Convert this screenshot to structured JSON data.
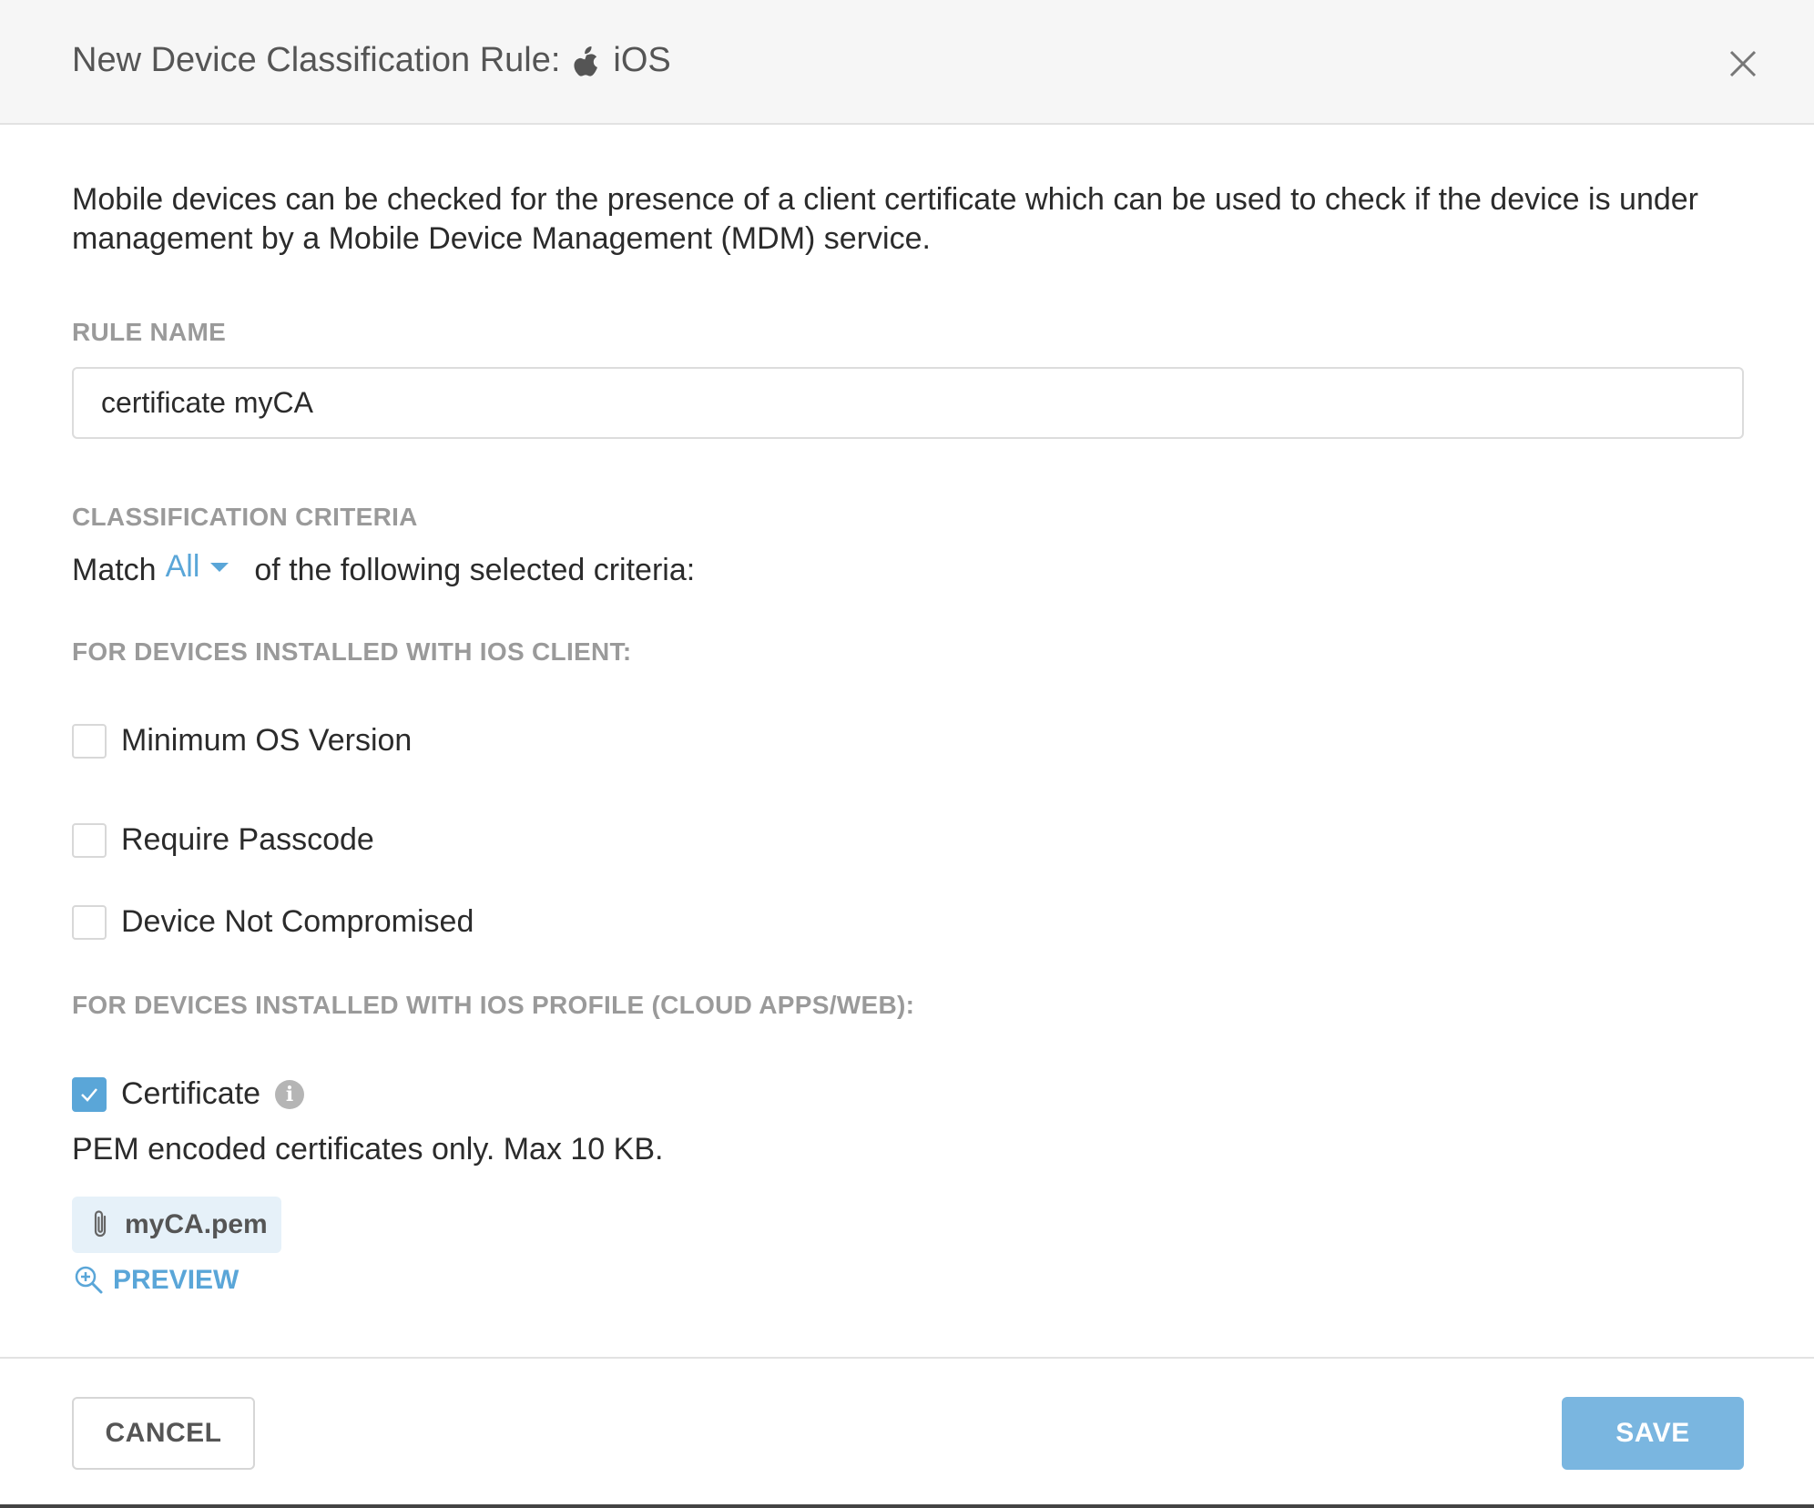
{
  "dialog": {
    "title": "New Device Classification Rule:",
    "platform": "iOS",
    "platform_icon": "apple-icon",
    "close_icon": "close-icon"
  },
  "description": "Mobile devices can be checked for the presence of a client certificate which can be used to check if the device is under management by a Mobile Device Management (MDM) service.",
  "rule_name": {
    "label": "RULE NAME",
    "value": "certificate myCA"
  },
  "classification": {
    "label": "CLASSIFICATION CRITERIA",
    "match_prefix": "Match",
    "match_value": "All",
    "match_suffix": "of the following selected criteria:"
  },
  "ios_client": {
    "label": "FOR DEVICES INSTALLED WITH IOS CLIENT:",
    "criteria": [
      {
        "label": "Minimum OS Version",
        "checked": false
      },
      {
        "label": "Require Passcode",
        "checked": false
      },
      {
        "label": "Device Not Compromised",
        "checked": false
      }
    ]
  },
  "ios_profile": {
    "label": "FOR DEVICES INSTALLED WITH IOS PROFILE (CLOUD APPS/WEB):",
    "certificate_label": "Certificate",
    "certificate_checked": true,
    "hint": "PEM encoded certificates only. Max 10 KB.",
    "file_name": "myCA.pem",
    "preview_label": "PREVIEW"
  },
  "footer": {
    "cancel_label": "CANCEL",
    "save_label": "SAVE"
  },
  "colors": {
    "accent": "#5aa6d8",
    "save_button": "#7ab6e0",
    "header_bg": "#f6f6f6"
  }
}
